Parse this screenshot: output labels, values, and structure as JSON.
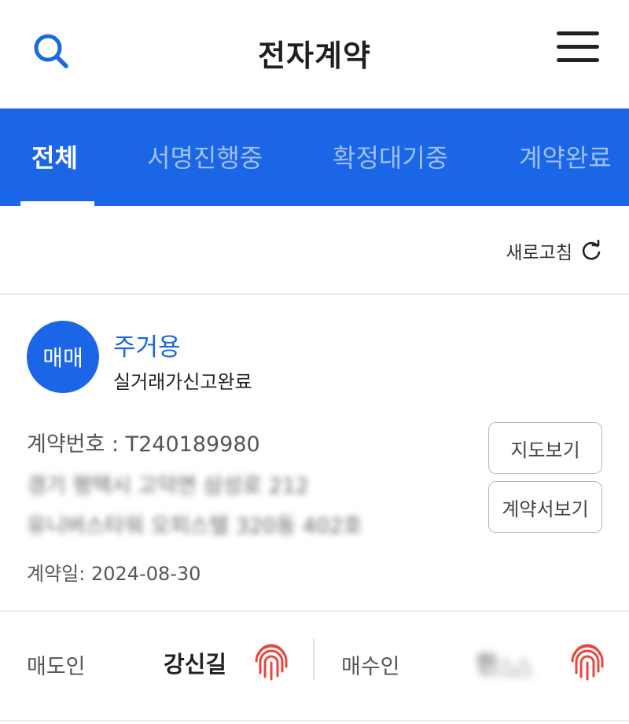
{
  "header": {
    "title": "전자계약",
    "search_icon": "search-icon",
    "menu_icon": "hamburger-menu-icon"
  },
  "tabs": [
    {
      "label": "전체",
      "active": true
    },
    {
      "label": "서명진행중",
      "active": false
    },
    {
      "label": "확정대기중",
      "active": false
    },
    {
      "label": "계약완료",
      "active": false
    }
  ],
  "refresh": {
    "label": "새로고침",
    "icon": "refresh-icon"
  },
  "contract": {
    "badge": "매매",
    "type": "주거용",
    "status": "실거래가신고완료",
    "number_label": "계약번호 : T240189980",
    "address_line1": "경기 평택시 고덕면 삼성로 212",
    "address_line2": "유니버스타워 오피스텔 320동 402호",
    "date_label": "계약일: 2024-08-30",
    "map_button": "지도보기",
    "contract_button": "계약서보기"
  },
  "parties": {
    "seller_label": "매도인",
    "seller_name": "강신길",
    "buyer_label": "매수인",
    "buyer_name": "한△△"
  },
  "colors": {
    "accent": "#1a66e6",
    "tab_inactive": "#9fc0f7",
    "fingerprint": "#e8463e"
  }
}
